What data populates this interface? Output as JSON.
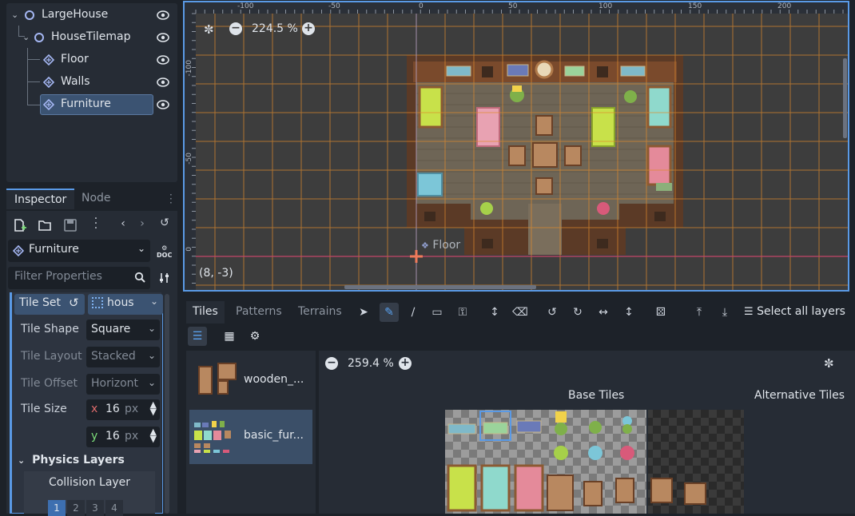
{
  "scene_tree": {
    "nodes": [
      {
        "label": "LargeHouse",
        "depth": 0,
        "icon": "node2d-icon"
      },
      {
        "label": "HouseTilemap",
        "depth": 1,
        "icon": "node2d-icon"
      },
      {
        "label": "Floor",
        "depth": 2,
        "icon": "tilemap-layer-icon"
      },
      {
        "label": "Walls",
        "depth": 2,
        "icon": "tilemap-layer-icon"
      },
      {
        "label": "Furniture",
        "depth": 2,
        "icon": "tilemap-layer-icon",
        "selected": true
      }
    ]
  },
  "inspector": {
    "tabs": [
      "Inspector",
      "Node"
    ],
    "selected_node": "Furniture",
    "doc_label": "DOC",
    "filter_placeholder": "Filter Properties",
    "tileset_label": "Tile Set",
    "tileset_value": "hous",
    "properties": [
      {
        "label": "Tile Shape",
        "value": "Square",
        "dim": false
      },
      {
        "label": "Tile Layout",
        "value": "Stacked",
        "dim": true
      },
      {
        "label": "Tile Offset",
        "value": "Horizont",
        "dim": true
      }
    ],
    "tile_size": {
      "label": "Tile Size",
      "x_label": "x",
      "x": "16",
      "y_label": "y",
      "y": "16",
      "unit": "px"
    },
    "physics_layers": "Physics Layers",
    "collision_layer": "Collision Layer",
    "layer_buttons": [
      "1",
      "2",
      "3",
      "4"
    ]
  },
  "viewport": {
    "zoom": "224.5 %",
    "coords": "(8, -3)",
    "floor_label": "Floor",
    "ruler_top": [
      "-100",
      "-50",
      "0",
      "50",
      "100",
      "150",
      "200"
    ],
    "ruler_left": [
      "-100",
      "-50",
      "0"
    ]
  },
  "bottom": {
    "tabs": [
      "Tiles",
      "Patterns",
      "Terrains"
    ],
    "select_all": "Select all layers",
    "zoom": "259.4 %",
    "base_tiles": "Base Tiles",
    "alt_tiles": "Alternative Tiles",
    "sources": [
      {
        "label": "wooden_..."
      },
      {
        "label": "basic_fur...",
        "selected": true
      }
    ]
  },
  "colors": {
    "accent": "#5a9ae6",
    "grid": "#e08c2c",
    "panel": "#262c35"
  }
}
